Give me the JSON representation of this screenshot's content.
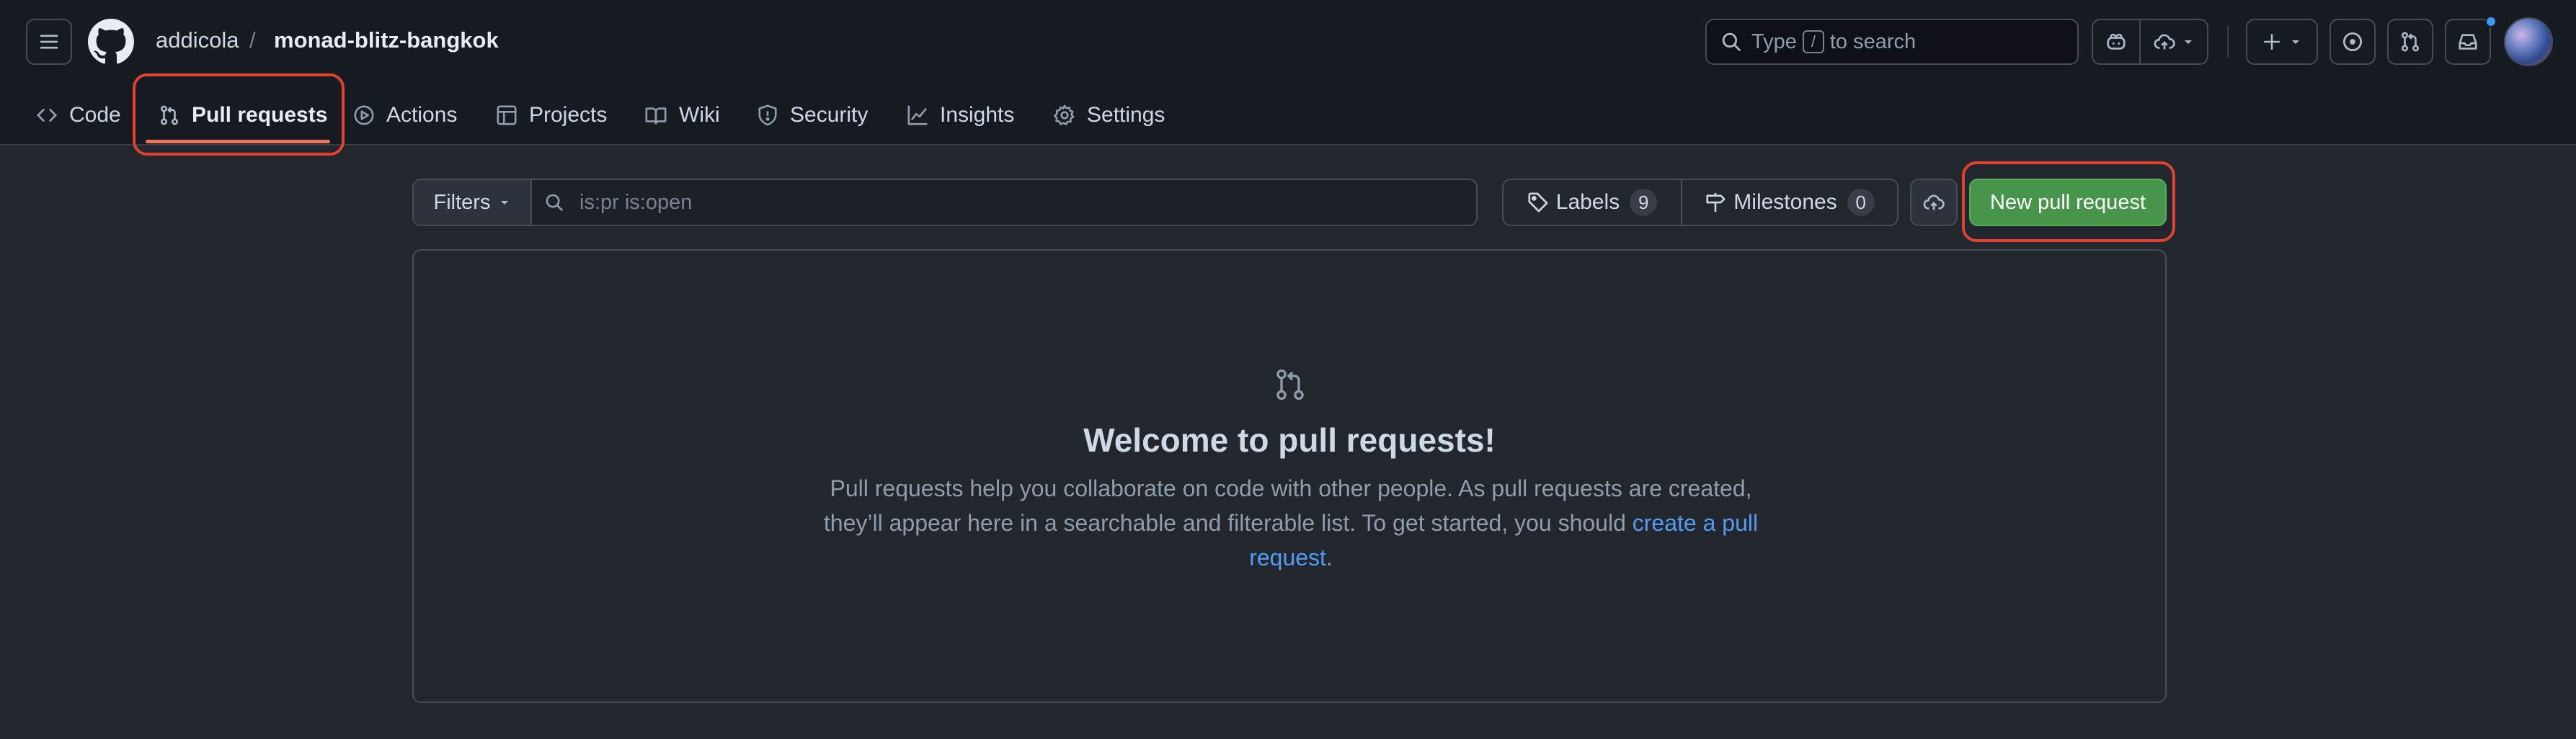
{
  "header": {
    "owner": "addicola",
    "separator": "/",
    "repo": "monad-blitz-bangkok",
    "search": {
      "prefix": "Type",
      "key": "/",
      "suffix": "to search"
    },
    "icons": [
      "hamburger-menu-icon",
      "github-logo-icon",
      "search-icon",
      "copilot-icon",
      "cloud-upload-icon",
      "plus-icon",
      "issue-circle-icon",
      "pull-request-icon",
      "inbox-icon"
    ]
  },
  "tabs": [
    {
      "label": "Code",
      "icon": "code-icon"
    },
    {
      "label": "Pull requests",
      "icon": "pull-request-icon",
      "active": true
    },
    {
      "label": "Actions",
      "icon": "play-icon"
    },
    {
      "label": "Projects",
      "icon": "table-icon"
    },
    {
      "label": "Wiki",
      "icon": "book-icon"
    },
    {
      "label": "Security",
      "icon": "shield-icon"
    },
    {
      "label": "Insights",
      "icon": "graph-icon"
    },
    {
      "label": "Settings",
      "icon": "gear-icon"
    }
  ],
  "toolbar": {
    "filters_label": "Filters",
    "filter_value": "is:pr is:open",
    "labels_label": "Labels",
    "labels_count": "9",
    "milestones_label": "Milestones",
    "milestones_count": "0",
    "new_pr_label": "New pull request"
  },
  "blankslate": {
    "title": "Welcome to pull requests!",
    "text": "Pull requests help you collaborate on code with other people. As pull requests are created, they’ll appear here in a searchable and filterable list. To get started, you should",
    "link": "create a pull request",
    "end": "."
  },
  "colors": {
    "accent_underline": "#ec775c",
    "primary_button": "#46954a",
    "link": "#539bf5",
    "highlight_box": "#e0422d"
  }
}
